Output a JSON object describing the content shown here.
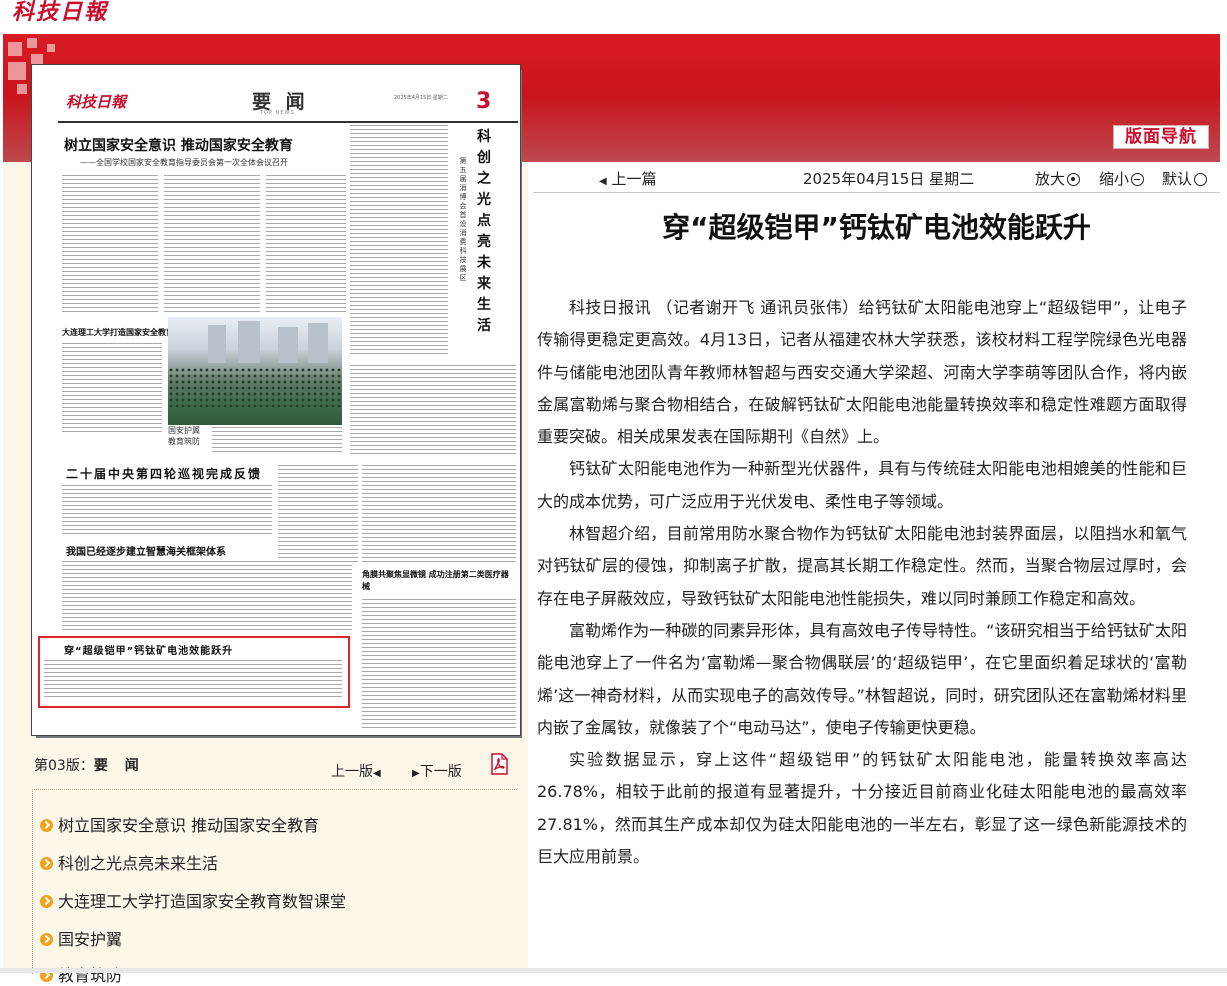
{
  "site_logo": "科技日報",
  "nav_button": "版面导航",
  "newspaper": {
    "logo": "科技日報",
    "section": "要 闻",
    "section_sub": "TOP NEWS",
    "page_number": "3",
    "date_line": "2025年4月15日 星期二",
    "headline_main": "树立国家安全意识  推动国家安全教育",
    "headline_sub": "——全国学校国家安全教育指导委员会第一次全体会议召开",
    "headline_vertical": "科创之光点亮未来生活",
    "headline_vertical_sub": "第五届消博会首设消费科技展区",
    "headline_dalian": "大连理工大学打造国家安全教育数智课堂",
    "photo_caption": "国安护翼 教育筑防",
    "headline_inspect": "二十届中央第四轮巡视完成反馈",
    "headline_customs": "我国已经逐步建立智慧海关框架体系",
    "headline_device": "角膜共聚焦显微镜 成功注册第二类医疗器械",
    "headline_battery": "穿“超级铠甲”钙钛矿电池效能跃升"
  },
  "page_info": {
    "label": "第03版：",
    "section": "要 闻",
    "prev_page": "上一版",
    "next_page": "下一版",
    "pdf_icon": "pdf-icon"
  },
  "article_list": [
    "树立国家安全意识 推动国家安全教育",
    "科创之光点亮未来生活",
    "大连理工大学打造国家安全教育数智课堂",
    "国安护翼",
    "教育筑防"
  ],
  "toolbar": {
    "prev_article": "上一篇",
    "date": "2025年04月15日  星期二",
    "zoom_in": "放大",
    "zoom_out": "缩小",
    "default": "默认"
  },
  "article": {
    "title": "穿“超级铠甲”钙钛矿电池效能跃升",
    "paragraphs": [
      "科技日报讯  （记者谢开飞  通讯员张伟）给钙钛矿太阳能电池穿上“超级铠甲”，让电子传输得更稳定更高效。4月13日，记者从福建农林大学获悉，该校材料工程学院绿色光电器件与储能电池团队青年教师林智超与西安交通大学梁超、河南大学李萌等团队合作，将内嵌金属富勒烯与聚合物相结合，在破解钙钛矿太阳能电池能量转换效率和稳定性难题方面取得重要突破。相关成果发表在国际期刊《自然》上。",
      "钙钛矿太阳能电池作为一种新型光伏器件，具有与传统硅太阳能电池相媲美的性能和巨大的成本优势，可广泛应用于光伏发电、柔性电子等领域。",
      "林智超介绍，目前常用防水聚合物作为钙钛矿太阳能电池封装界面层，以阻挡水和氧气对钙钛矿层的侵蚀，抑制离子扩散，提高其长期工作稳定性。然而，当聚合物层过厚时，会存在电子屏蔽效应，导致钙钛矿太阳能电池性能损失，难以同时兼顾工作稳定和高效。",
      "富勒烯作为一种碳的同素异形体，具有高效电子传导特性。“该研究相当于给钙钛矿太阳能电池穿上了一件名为‘富勒烯—聚合物偶联层’的‘超级铠甲’，在它里面织着足球状的‘富勒烯’这一神奇材料，从而实现电子的高效传导。”林智超说，同时，研究团队还在富勒烯材料里内嵌了金属钕，就像装了个“电动马达”，使电子传输更快更稳。",
      "实验数据显示，穿上这件“超级铠甲”的钙钛矿太阳能电池，能量转换效率高达26.78%，相较于此前的报道有显著提升，十分接近目前商业化硅太阳能电池的最高效率27.81%，然而其生产成本却仅为硅太阳能电池的一半左右，彰显了这一绿色新能源技术的巨大应用前景。"
    ]
  },
  "colors": {
    "brand_red": "#c8102e",
    "banner_red": "#d91c24",
    "left_bg": "#fdf7e9",
    "bullet_orange": "#f0a21c"
  }
}
